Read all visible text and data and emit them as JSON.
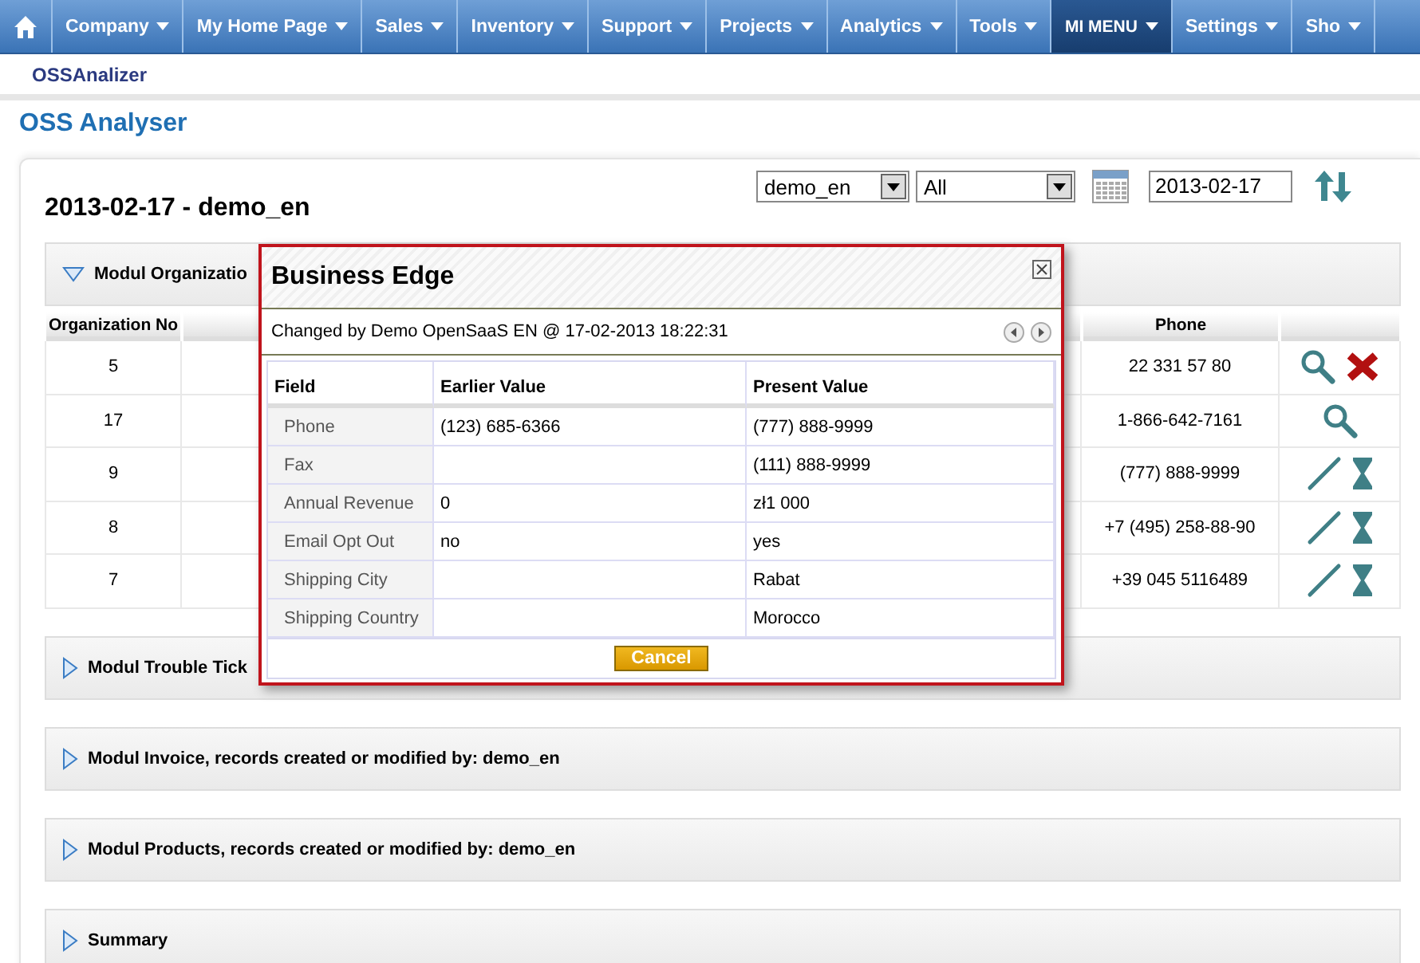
{
  "nav": {
    "items": [
      {
        "label": "Company",
        "selected": false
      },
      {
        "label": "My Home Page",
        "selected": false
      },
      {
        "label": "Sales",
        "selected": false
      },
      {
        "label": "Inventory",
        "selected": false
      },
      {
        "label": "Support",
        "selected": false
      },
      {
        "label": "Projects",
        "selected": false
      },
      {
        "label": "Analytics",
        "selected": false
      },
      {
        "label": "Tools",
        "selected": false
      },
      {
        "label": "MI MENU",
        "selected": true
      },
      {
        "label": "Settings",
        "selected": false
      },
      {
        "label": "Sho",
        "selected": false
      }
    ]
  },
  "breadcrumb": "OSSAnalizer",
  "page_title": "OSS Analyser",
  "panel": {
    "heading": "2013-02-17 - demo_en",
    "user_select": "demo_en",
    "filter_select": "All",
    "date": "2013-02-17",
    "sections": [
      {
        "title": "Modul Organizatio",
        "expanded": true,
        "table": {
          "columns": [
            "Organization No",
            "Phone"
          ],
          "rows": [
            {
              "number": "5",
              "phone": "22 331 57 80",
              "actions": [
                {
                  "kind": "search"
                },
                {
                  "kind": "delete"
                }
              ]
            },
            {
              "number": "17",
              "phone": "1-866-642-7161",
              "actions": [
                {
                  "kind": "search"
                }
              ]
            },
            {
              "number": "9",
              "phone": "(777) 888-9999",
              "actions": [
                {
                  "kind": "edit"
                },
                {
                  "kind": "history"
                }
              ]
            },
            {
              "number": "8",
              "phone": "+7 (495) 258-88-90",
              "actions": [
                {
                  "kind": "edit"
                },
                {
                  "kind": "history"
                }
              ]
            },
            {
              "number": "7",
              "phone": "+39 045 5116489",
              "actions": [
                {
                  "kind": "edit"
                },
                {
                  "kind": "history"
                }
              ]
            }
          ]
        }
      },
      {
        "title": "Modul Trouble Tick",
        "expanded": false
      },
      {
        "title": "Modul Invoice, records created or modified by: demo_en",
        "expanded": false
      },
      {
        "title": "Modul Products, records created or modified by: demo_en",
        "expanded": false
      },
      {
        "title": "Summary",
        "expanded": false
      }
    ]
  },
  "dialog": {
    "title": "Business Edge",
    "changed_by": "Changed by Demo OpenSaaS EN @ 17-02-2013 18:22:31",
    "columns": [
      "Field",
      "Earlier Value",
      "Present Value"
    ],
    "rows": [
      {
        "field": "Phone",
        "earlier": "(123) 685-6366",
        "present": "(777) 888-9999"
      },
      {
        "field": "Fax",
        "earlier": "",
        "present": "(111) 888-9999"
      },
      {
        "field": "Annual Revenue",
        "earlier": "0",
        "present": "zł1 000"
      },
      {
        "field": "Email Opt Out",
        "earlier": "no",
        "present": "yes"
      },
      {
        "field": "Shipping City",
        "earlier": "",
        "present": "Rabat"
      },
      {
        "field": "Shipping Country",
        "earlier": "",
        "present": "Morocco"
      }
    ],
    "cancel": "Cancel"
  }
}
